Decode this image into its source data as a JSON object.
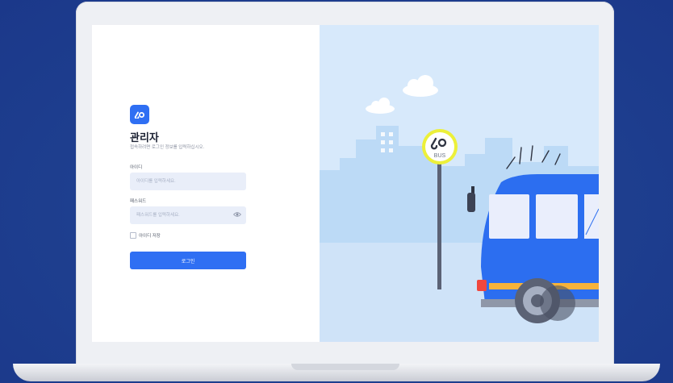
{
  "login": {
    "title": "관리자",
    "subtitle": "접속하려면 로그인 정보를 입력하십시오.",
    "id_label": "아이디",
    "id_placeholder": "아이디를 입력하세요.",
    "password_label": "패스워드",
    "password_placeholder": "패스워드를 입력하세요.",
    "remember_label": "아이디 저장",
    "login_button": "로그인",
    "logo_icon": "infinity-link-icon"
  },
  "illustration": {
    "sign_text": "BUS",
    "icons": [
      "cloud-icon",
      "bus-stop-sign-icon",
      "bus-icon"
    ]
  },
  "colors": {
    "background": "#1e3f8f",
    "accent": "#2f6ff3",
    "input_bg": "#e9eef9",
    "sky": "#d7e9fb",
    "bus_blue": "#2c6ef0",
    "sign_ring": "#ecf03a"
  }
}
